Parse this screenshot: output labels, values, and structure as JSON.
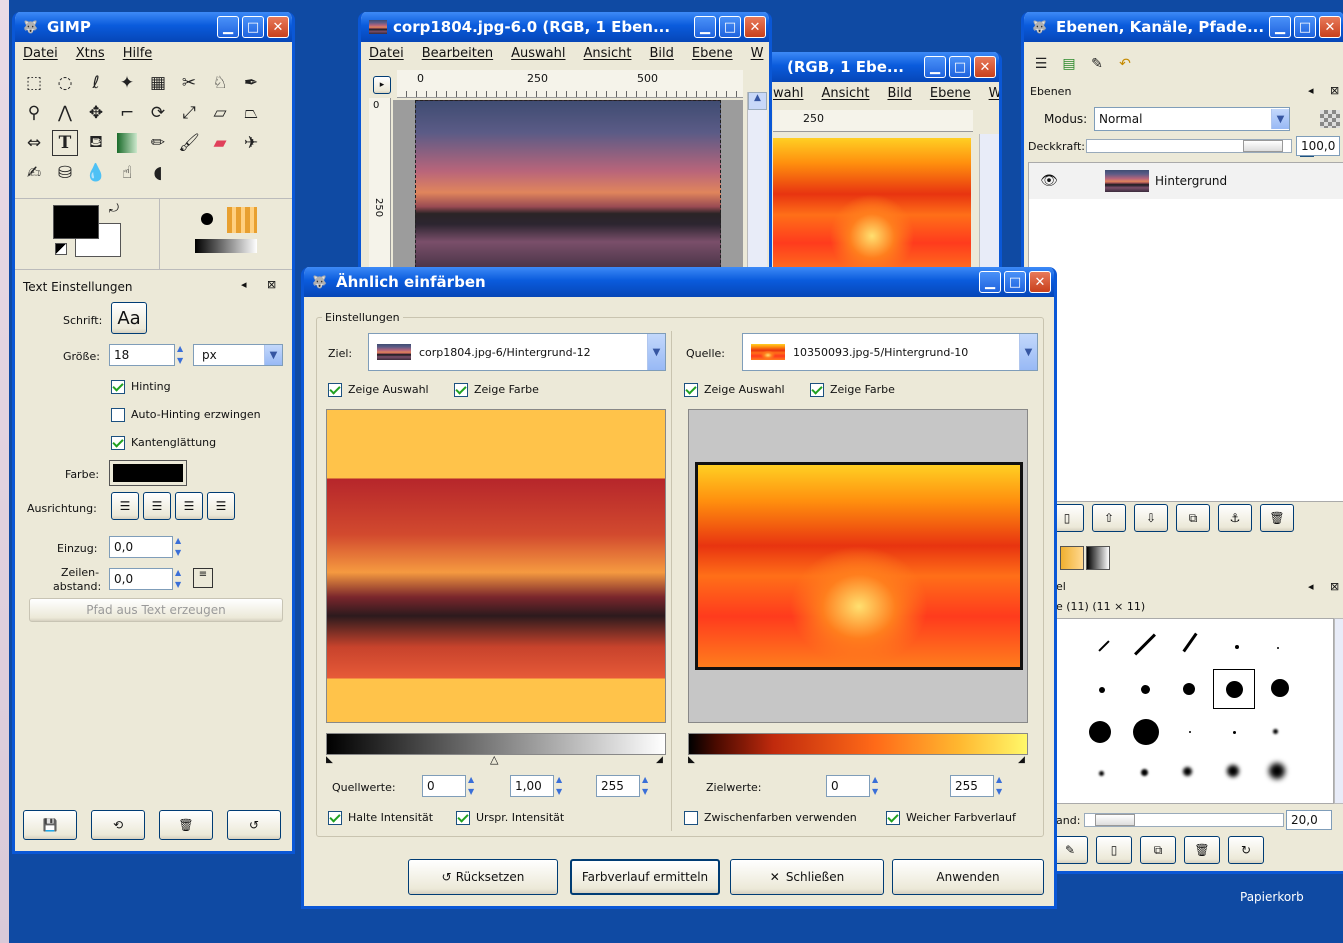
{
  "colors": {
    "desktop": "#0f4aa3",
    "titlebar": "#0a5bdc",
    "window_bg": "#ece9d8"
  },
  "desktop": {
    "recycle_bin_label": "Papierkorb"
  },
  "toolbox": {
    "title": "GIMP",
    "menu": [
      "Datei",
      "Xtns",
      "Hilfe"
    ],
    "tools": [
      "rect-select",
      "ellipse-select",
      "lasso",
      "fuzzy-select",
      "select-by-color",
      "scissors",
      "foreground-select",
      "paths",
      "color-picker",
      "zoom",
      "measure",
      "move",
      "crop",
      "rotate",
      "scale",
      "shear",
      "perspective",
      "flip",
      "text",
      "bucket-fill",
      "blend",
      "pencil",
      "paintbrush",
      "eraser",
      "airbrush",
      "ink",
      "clone",
      "heal",
      "smudge",
      "dodge",
      "convolve"
    ],
    "text_options": {
      "header": "Text Einstellungen",
      "font_label": "Schrift:",
      "font_value": "Aa",
      "size_label": "Größe:",
      "size_value": "18",
      "unit_value": "px",
      "hinting_label": "Hinting",
      "autohint_label": "Auto-Hinting erzwingen",
      "antialias_label": "Kantenglättung",
      "color_label": "Farbe:",
      "justify_label": "Ausrichtung:",
      "indent_label": "Einzug:",
      "indent_value": "0,0",
      "line_spacing_label_1": "Zeilen-",
      "line_spacing_label_2": "abstand:",
      "line_spacing_value": "0,0",
      "path_button": "Pfad aus Text erzeugen"
    }
  },
  "image_window_1": {
    "title": "corp1804.jpg-6.0 (RGB, 1 Eben...",
    "menu": [
      "Datei",
      "Bearbeiten",
      "Auswahl",
      "Ansicht",
      "Bild",
      "Ebene",
      "W"
    ],
    "ruler_ticks": [
      "0",
      "250",
      "500"
    ],
    "vruler_ticks": [
      "0",
      "250"
    ]
  },
  "image_window_2": {
    "title": "(RGB, 1 Ebe...",
    "menu": [
      "wahl",
      "Ansicht",
      "Bild",
      "Ebene",
      "W"
    ],
    "ruler_ticks": [
      "250"
    ]
  },
  "layers_dock": {
    "title": "Ebenen, Kanäle, Pfade...",
    "section_label": "Ebenen",
    "mode_label": "Modus:",
    "mode_value": "Normal",
    "opacity_label": "Deckkraft:",
    "opacity_value": "100,0",
    "layer_name": "Hintergrund",
    "brushes_label_1": "el",
    "brushes_label_2": "e (11) (11 × 11)",
    "spacing_label": "and:",
    "spacing_value": "20,0"
  },
  "dialog": {
    "title": "Ähnlich einfärben",
    "settings_label": "Einstellungen",
    "target_label": "Ziel:",
    "target_value": "corp1804.jpg-6/Hintergrund-12",
    "source_label": "Quelle:",
    "source_value": "10350093.jpg-5/Hintergrund-10",
    "show_selection": "Zeige Auswahl",
    "show_color": "Zeige Farbe",
    "source_values_label": "Quellwerte:",
    "source_values": [
      "0",
      "1,00",
      "255"
    ],
    "target_values_label": "Zielwerte:",
    "target_values": [
      "0",
      "255"
    ],
    "keep_intensity": "Halte Intensität",
    "orig_intensity": "Urspr. Intensität",
    "intermediate_colors": "Zwischenfarben verwenden",
    "smooth_gradient": "Weicher Farbverlauf",
    "buttons": {
      "reset": "Rücksetzen",
      "get_gradient": "Farbverlauf ermitteln",
      "close": "Schließen",
      "apply": "Anwenden"
    }
  }
}
